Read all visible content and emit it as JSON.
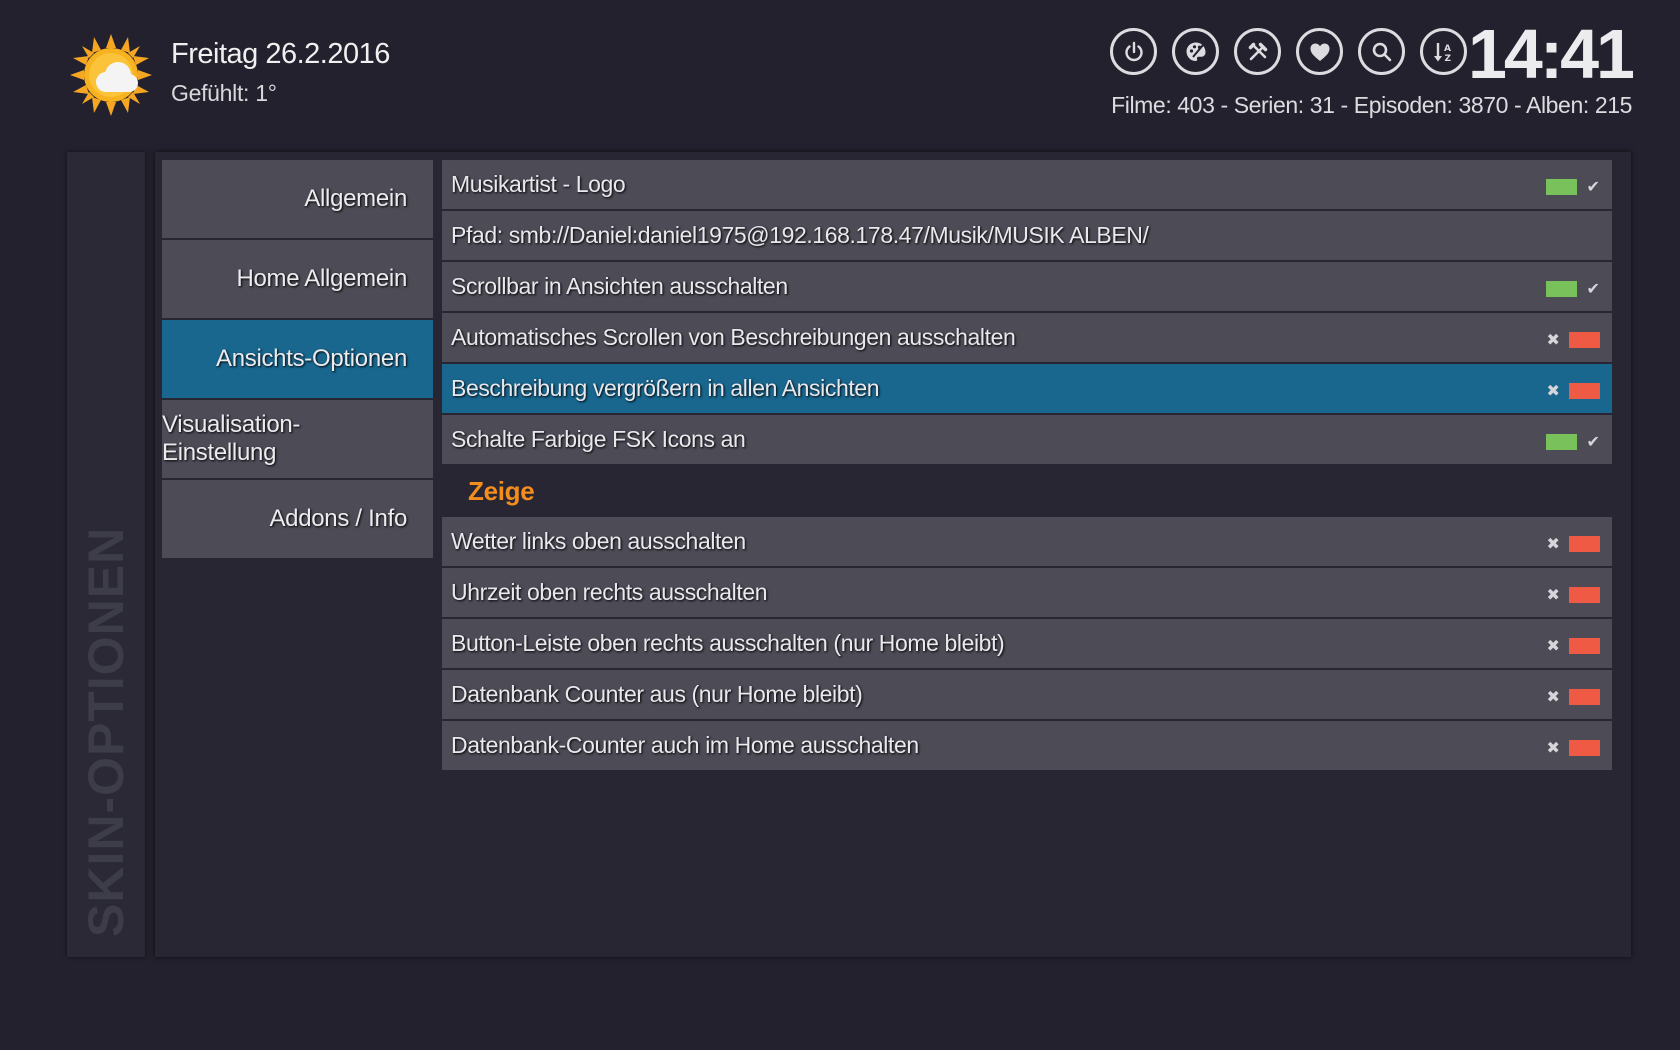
{
  "header": {
    "date": "Freitag  26.2.2016",
    "feels": "Gefühlt: 1°",
    "time": "14:41",
    "counter": "Filme: 403 - Serien: 31 - Episoden: 3870 - Alben: 215",
    "icons": [
      "power-icon",
      "palette-icon",
      "tools-icon",
      "heart-icon",
      "search-icon",
      "sort-az-icon"
    ]
  },
  "side_label": "SKIN-OPTIONEN",
  "categories": [
    {
      "label": "Allgemein"
    },
    {
      "label": "Home Allgemein"
    },
    {
      "label": "Ansichts-Optionen",
      "active": true
    },
    {
      "label": "Visualisation-Einstellung"
    },
    {
      "label": "Addons / Info"
    }
  ],
  "options": [
    {
      "label": "Musikartist - Logo",
      "state": "on"
    },
    {
      "label": "Pfad: smb://Daniel:daniel1975@192.168.178.47/Musik/MUSIK ALBEN/",
      "state": "none"
    },
    {
      "label": "Scrollbar in Ansichten ausschalten",
      "state": "on"
    },
    {
      "label": "Automatisches Scrollen von Beschreibungen ausschalten",
      "state": "off"
    },
    {
      "label": "Beschreibung vergrößern in allen Ansichten",
      "state": "off",
      "active": true
    },
    {
      "label": "Schalte Farbige FSK Icons an",
      "state": "on"
    }
  ],
  "section_label": "Zeige",
  "options2": [
    {
      "label": "Wetter links oben ausschalten",
      "state": "off"
    },
    {
      "label": "Uhrzeit oben rechts ausschalten",
      "state": "off"
    },
    {
      "label": "Button-Leiste oben rechts ausschalten (nur Home bleibt)",
      "state": "off"
    },
    {
      "label": "Datenbank Counter aus (nur Home bleibt)",
      "state": "off"
    },
    {
      "label": "Datenbank-Counter auch im Home ausschalten",
      "state": "off"
    }
  ],
  "colors": {
    "accent": "#19668e",
    "on": "#79c15a",
    "off": "#ee5a44",
    "section": "#f28d1e"
  }
}
